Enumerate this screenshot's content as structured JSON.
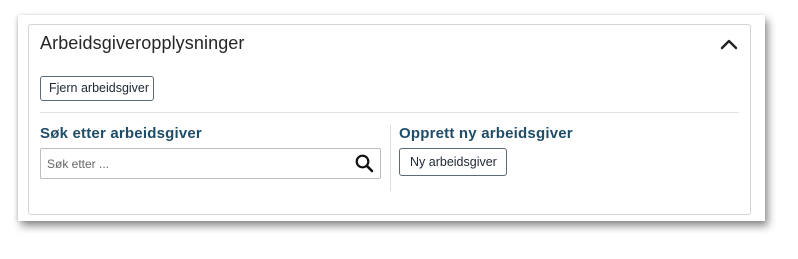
{
  "panel": {
    "title": "Arbeidsgiveropplysninger",
    "collapse_icon": "chevron-up-icon"
  },
  "actions": {
    "remove_employer_label": "Fjern arbeidsgiver"
  },
  "search": {
    "heading": "Søk etter arbeidsgiver",
    "placeholder": "Søk etter ...",
    "value": "",
    "icon": "search-icon"
  },
  "create": {
    "heading": "Opprett ny arbeidsgiver",
    "button_label": "Ny arbeidsgiver"
  },
  "colors": {
    "heading": "#1f4d68",
    "border": "#d4d4d4",
    "button_border": "#5d6a78"
  }
}
